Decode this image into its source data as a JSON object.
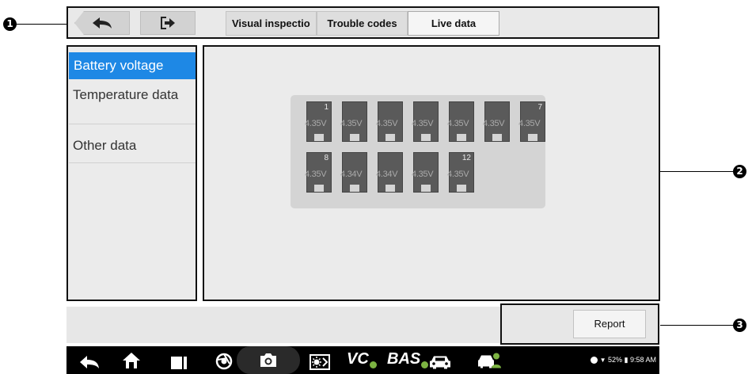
{
  "callouts": [
    "1",
    "2",
    "3"
  ],
  "toolbar": {
    "back_icon": "back-arrow-icon",
    "exit_icon": "exit-icon",
    "tabs": [
      "Visual inspectio",
      "Trouble codes",
      "Live data"
    ],
    "active_tab": "Live data"
  },
  "sidebar": {
    "items": [
      {
        "label": "Battery voltage",
        "active": true
      },
      {
        "label": "Temperature data",
        "active": false
      },
      {
        "label": "Other data",
        "active": false
      }
    ]
  },
  "battery_cells": {
    "row1": {
      "index_labels": [
        "1",
        "",
        "",
        "",
        "",
        "",
        "7"
      ],
      "voltages": [
        "4.35V",
        "4.35V",
        "4.35V",
        "4.35V",
        "4.35V",
        "4.35V",
        "4.35V"
      ]
    },
    "row2": {
      "index_labels": [
        "8",
        "",
        "",
        "",
        "12"
      ],
      "voltages": [
        "4.35V",
        "4.34V",
        "4.34V",
        "4.35V",
        "4.35V"
      ]
    }
  },
  "footer": {
    "report_label": "Report"
  },
  "navbar": {
    "icons": [
      "back-icon",
      "home-icon",
      "recents-icon",
      "browser-icon",
      "camera-icon",
      "brightness-icon",
      "vci-icon",
      "bas-icon",
      "car-icon",
      "mechanic-icon"
    ],
    "vci_label": "VC",
    "bas_label": "BAS",
    "status": "52% ▮ 9:58 AM"
  },
  "colors": {
    "accent": "#1e88e5",
    "cell": "#5a5a5a"
  }
}
